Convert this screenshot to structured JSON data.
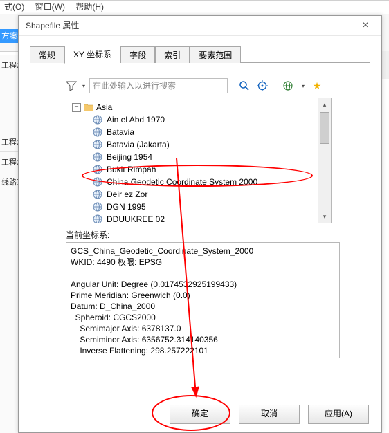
{
  "menubar": {
    "format": "式(O)",
    "window": "窗口(W)",
    "help": "帮助(H)"
  },
  "bg": {
    "scheme": "方案拍",
    "side1": "工程水",
    "side2": "工程水",
    "side3": "工程水",
    "side4": "线路工"
  },
  "dialog": {
    "title": "Shapefile 属性"
  },
  "tabs": [
    "常规",
    "XY 坐标系",
    "字段",
    "索引",
    "要素范围"
  ],
  "active_tab": 1,
  "search": {
    "placeholder": "在此处输入以进行搜索"
  },
  "tree": {
    "root": "Asia",
    "items": [
      "Ain el Abd 1970",
      "Batavia",
      "Batavia (Jakarta)",
      "Beijing 1954",
      "Bukit Rimpah",
      "China Geodetic Coordinate System 2000",
      "Deir ez Zor",
      "DGN 1995",
      "DDUUKREE 02"
    ]
  },
  "current_label": "当前坐标系:",
  "details_text": "GCS_China_Geodetic_Coordinate_System_2000\nWKID: 4490 权限: EPSG\n\nAngular Unit: Degree (0.0174532925199433)\nPrime Meridian: Greenwich (0.0)\nDatum: D_China_2000\n  Spheroid: CGCS2000\n    Semimajor Axis: 6378137.0\n    Semiminor Axis: 6356752.314140356\n    Inverse Flattening: 298.257222101",
  "buttons": {
    "ok": "确定",
    "cancel": "取消",
    "apply": "应用(A)"
  }
}
